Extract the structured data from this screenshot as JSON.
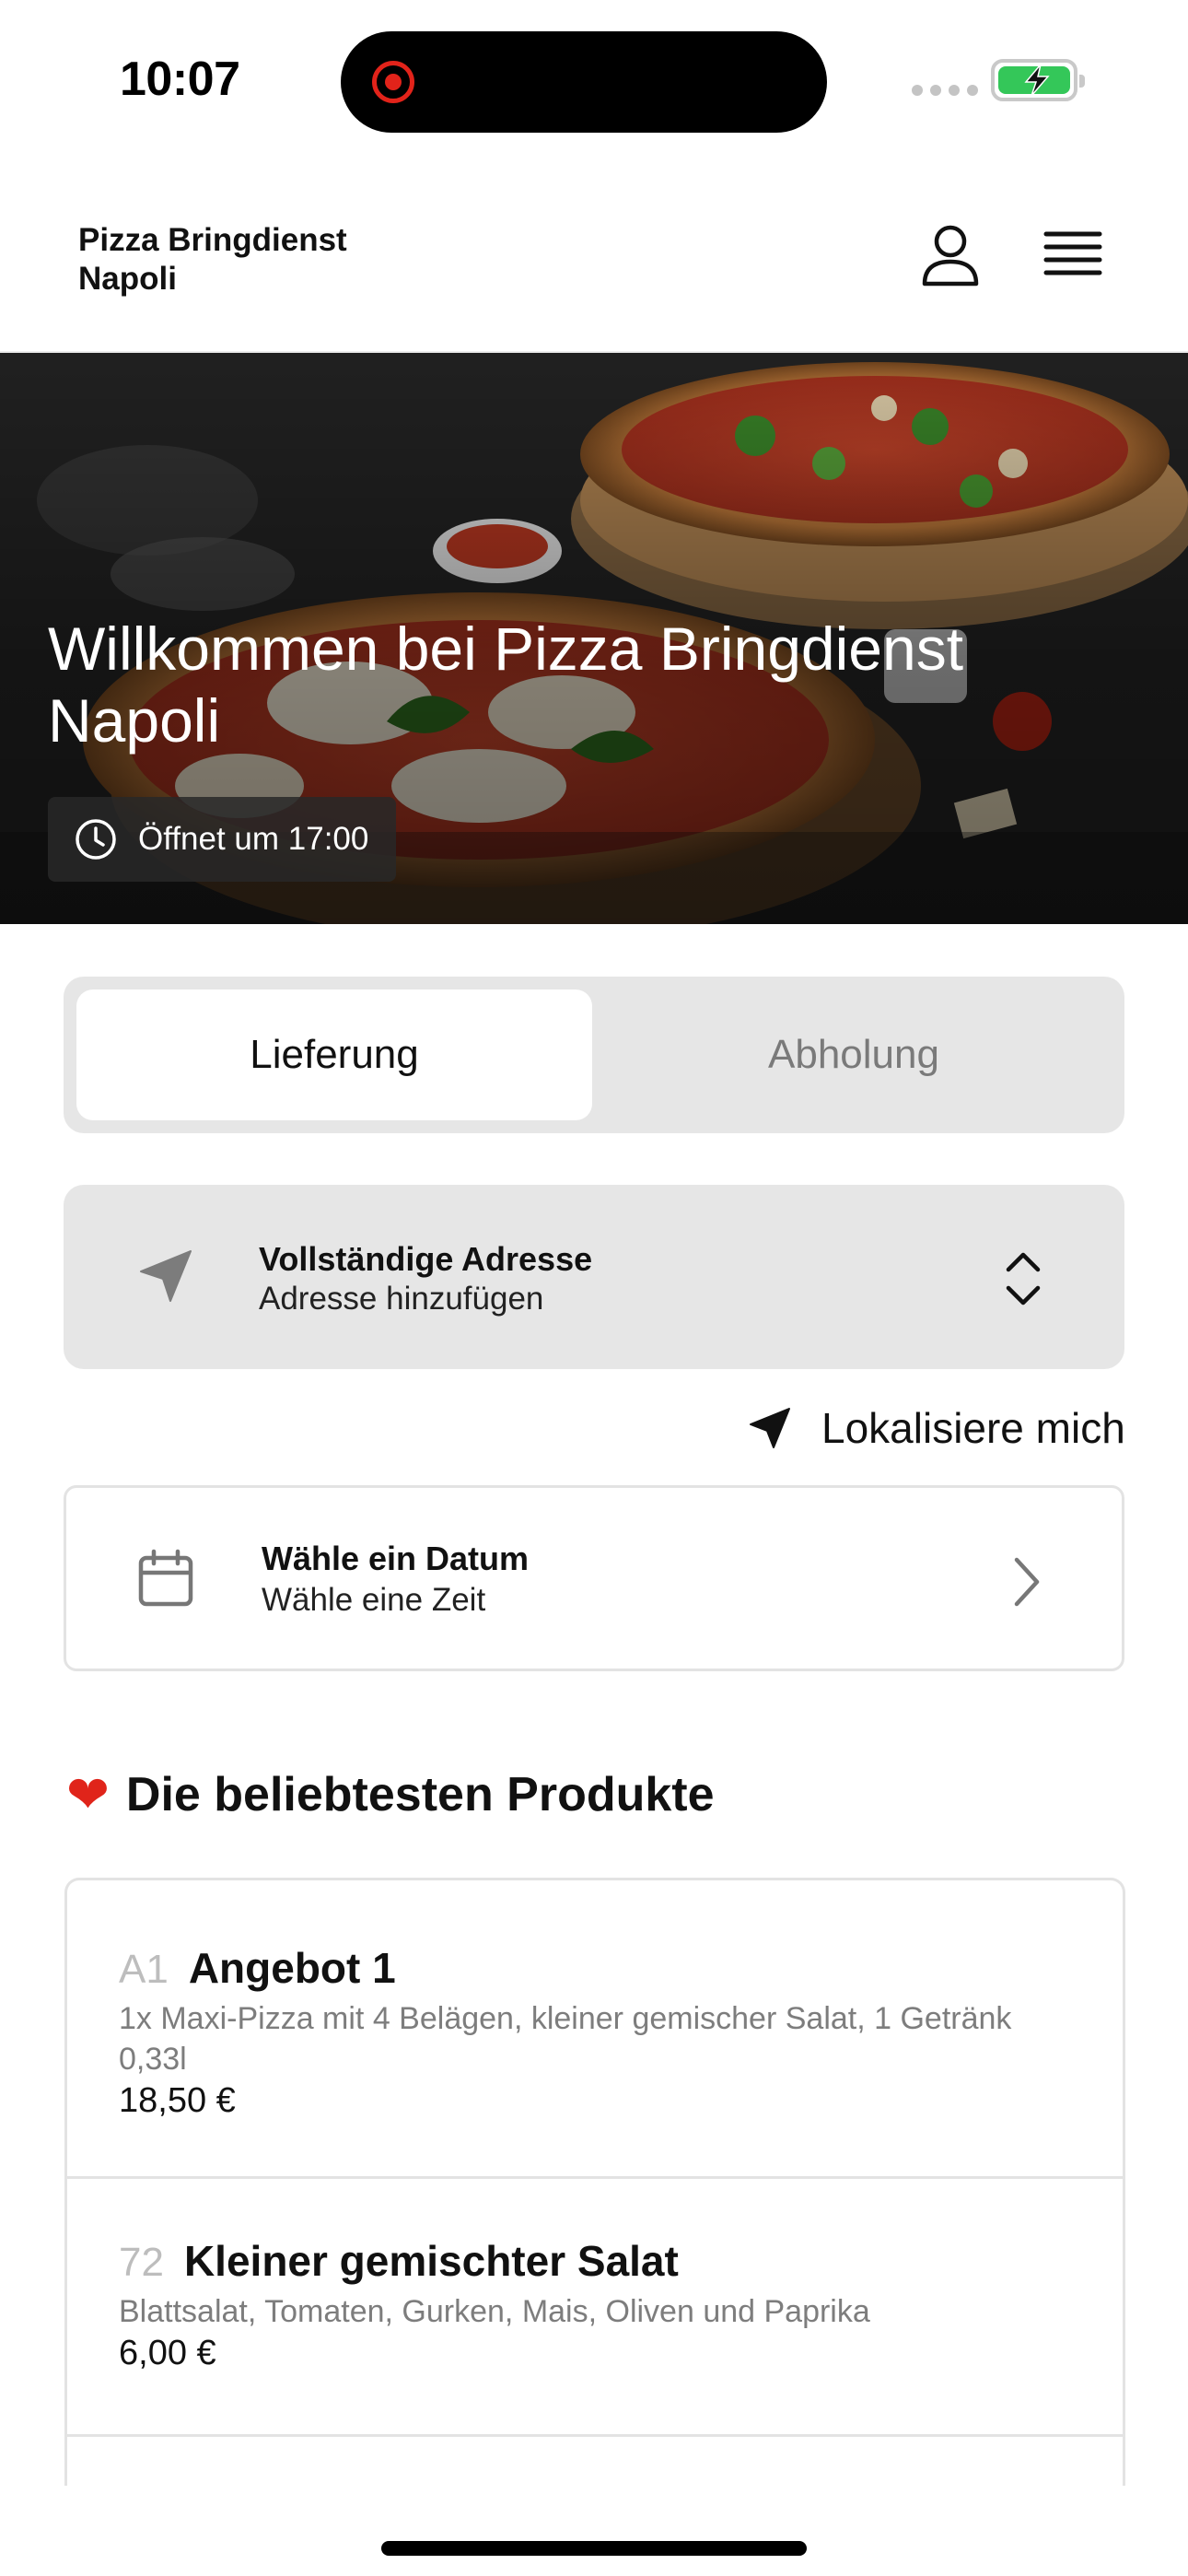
{
  "status_bar": {
    "time": "10:07"
  },
  "header": {
    "brand": "Pizza Bringdienst Napoli"
  },
  "hero": {
    "title": "Willkommen bei Pizza Bringdienst Napoli",
    "hours": "Öffnet um 17:00"
  },
  "order_mode": {
    "delivery": "Lieferung",
    "pickup": "Abholung",
    "selected": "Lieferung"
  },
  "address": {
    "label": "Vollständige Adresse",
    "placeholder": "Adresse hinzufügen"
  },
  "locate": {
    "label": "Lokalisiere mich"
  },
  "schedule": {
    "date_label": "Wähle ein Datum",
    "time_label": "Wähle eine Zeit"
  },
  "popular": {
    "heading": "Die beliebtesten Produkte",
    "items": [
      {
        "number": "A1",
        "name": "Angebot 1",
        "description": "1x Maxi-Pizza mit 4 Belägen, kleiner gemischer Salat, 1 Getränk 0,33l",
        "price": "18,50 €"
      },
      {
        "number": "72",
        "name": "Kleiner gemischter Salat",
        "description": "Blattsalat, Tomaten, Gurken, Mais, Oliven und Paprika",
        "price": "6,00 €"
      }
    ]
  },
  "icons": {
    "hero_hours": "clock-icon",
    "address": "navigation-arrow-icon",
    "address_toggle": "chevron-up-down-icon",
    "locate": "navigation-arrow-icon",
    "schedule": "calendar-icon",
    "schedule_open": "chevron-right-icon",
    "account": "user-icon",
    "menu": "hamburger-menu-icon",
    "popular": "heart-icon"
  },
  "colors": {
    "accent_red": "#e2231a",
    "battery_green": "#34c759",
    "panel_gray": "#e6e6e6",
    "muted_text": "#7d7d7d"
  }
}
